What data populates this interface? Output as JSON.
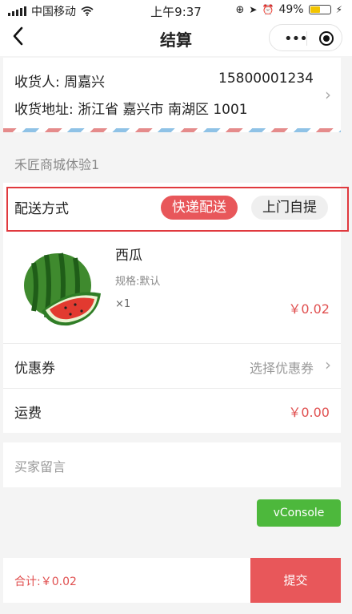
{
  "status_bar": {
    "carrier": "中国移动",
    "time": "上午9:37",
    "battery": "49%",
    "battery_level": 0.49
  },
  "nav": {
    "back_icon": "chevron-left-icon",
    "title": "结算",
    "more_icon": "more-dots-icon",
    "close_icon": "target-circle-icon"
  },
  "address": {
    "receiver": "收货人: 周嘉兴",
    "phone": "15800001234",
    "address": "收货地址: 浙江省 嘉兴市 南湖区 1001"
  },
  "shop": {
    "name": "禾匠商城体验1"
  },
  "delivery": {
    "label": "配送方式",
    "options": [
      "快递配送",
      "上门自提"
    ],
    "selected": "快递配送",
    "highlight_color": "#e0393e"
  },
  "product": {
    "name": "西瓜",
    "spec": "规格:默认",
    "qty": "×1",
    "price": "￥0.02",
    "image_icon": "watermelon-image"
  },
  "coupon": {
    "label": "优惠券",
    "value": "选择优惠券"
  },
  "shipping": {
    "label": "运费",
    "value": "￥0.00"
  },
  "message": {
    "placeholder": "买家留言"
  },
  "vconsole": {
    "label": "vConsole"
  },
  "footer": {
    "total": "合计:￥0.02",
    "submit": "提交",
    "accent": "#e8575a"
  }
}
